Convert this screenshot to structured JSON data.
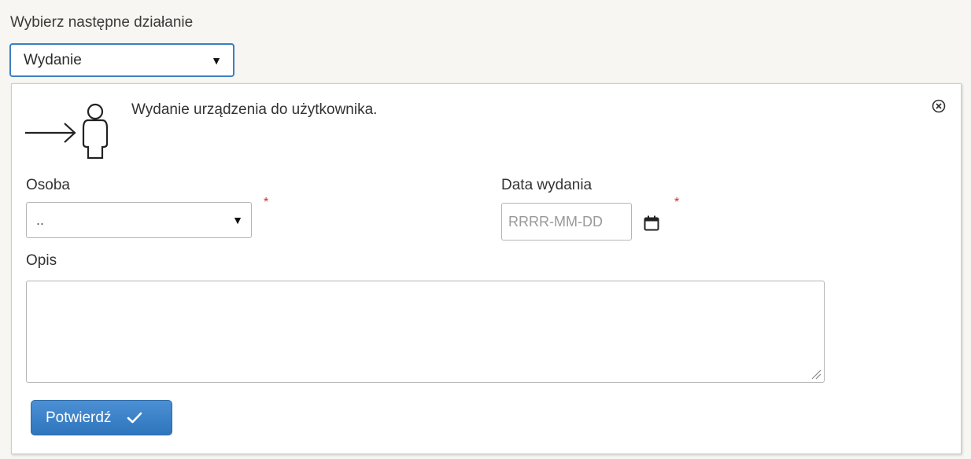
{
  "next_action": {
    "label": "Wybierz następne działanie",
    "selected": "Wydanie"
  },
  "panel": {
    "description": "Wydanie urządzenia do użytkownika.",
    "icon": "arrow-to-person-icon",
    "close_icon": "close-circle-icon"
  },
  "form": {
    "person": {
      "label": "Osoba",
      "selected": "..",
      "required_mark": "*"
    },
    "issue_date": {
      "label": "Data wydania",
      "placeholder": "RRRR-MM-DD",
      "value": "",
      "required_mark": "*",
      "icon": "calendar-icon"
    },
    "description": {
      "label": "Opis",
      "value": ""
    }
  },
  "confirm_button": {
    "label": "Potwierdź",
    "icon": "checkmark-icon"
  },
  "colors": {
    "accent": "#3b7fc4",
    "button_bg": "#337ab7",
    "required": "#c9302c",
    "page_bg": "#f7f6f2"
  }
}
